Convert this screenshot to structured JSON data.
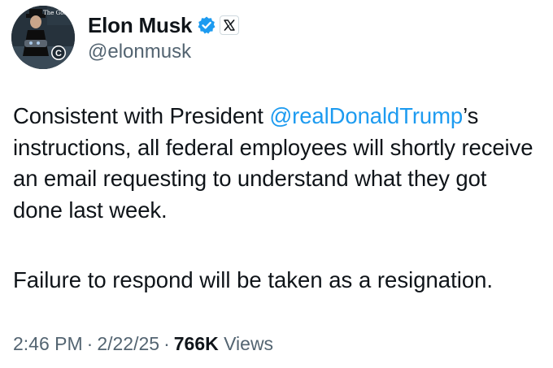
{
  "author": {
    "display_name": "Elon Musk",
    "handle": "@elonmusk",
    "verified_icon": "verified-badge-icon",
    "affiliate_icon": "x-logo-icon",
    "avatar_text": "The Gospel",
    "avatar_badge": "C"
  },
  "tweet": {
    "text_before_mention": "Consistent with President ",
    "mention": "@realDonaldTrump",
    "text_after_mention": "’s instructions, all federal employees will shortly receive an email requesting to understand what they got done last week.",
    "paragraph2": "Failure to respond will be taken as a resignation."
  },
  "meta": {
    "time": "2:46 PM",
    "date": "2/22/25",
    "views_count": "766K",
    "views_label": "Views",
    "separator": "·"
  },
  "colors": {
    "mention": "#1d9bf0",
    "muted": "#536471",
    "text": "#0f1419",
    "verified": "#1d9bf0"
  }
}
